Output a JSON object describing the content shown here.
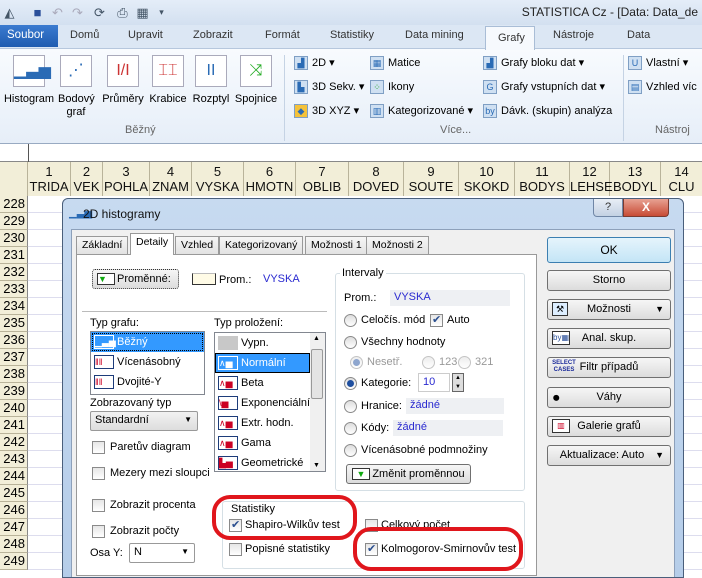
{
  "window": {
    "title": "STATISTICA Cz - [Data: Data_de"
  },
  "qat": {
    "icons": [
      "statistica-logo-icon",
      "save-icon",
      "undo-icon",
      "redo-icon",
      "refresh-icon",
      "print-icon",
      "customize-icon",
      "dropdown-icon"
    ]
  },
  "ribbon": {
    "file_tab": "Soubor",
    "tabs": [
      "Domů",
      "Upravit",
      "Zobrazit",
      "Formát",
      "Statistiky",
      "Data mining",
      "Grafy",
      "Nástroje",
      "Data"
    ],
    "active_tab": "Grafy",
    "groups": {
      "bezny": {
        "label": "Běžný",
        "buttons": [
          "Histogram",
          "Bodový graf",
          "Průměry",
          "Krabice",
          "Rozptyl",
          "Spojnice"
        ]
      },
      "vice": {
        "label": "Více...",
        "items": [
          "2D",
          "3D Sekv.",
          "3D XYZ",
          "Matice",
          "Ikony",
          "Kategorizované",
          "Grafy bloku dat",
          "Grafy vstupních dat",
          "Dávk. (skupin) analýza"
        ]
      },
      "nastroje": {
        "label": "Nástroj",
        "items": [
          "Vlastní",
          "Vzhled víc"
        ]
      }
    }
  },
  "grid": {
    "columns": [
      {
        "n": "1",
        "name": "TRIDA"
      },
      {
        "n": "2",
        "name": "VEK"
      },
      {
        "n": "3",
        "name": "POHLA"
      },
      {
        "n": "4",
        "name": "ZNAM"
      },
      {
        "n": "5",
        "name": "VYSKA"
      },
      {
        "n": "6",
        "name": "HMOTN"
      },
      {
        "n": "7",
        "name": "OBLIB"
      },
      {
        "n": "8",
        "name": "DOVED"
      },
      {
        "n": "9",
        "name": "SOUTE"
      },
      {
        "n": "10",
        "name": "SKOKD"
      },
      {
        "n": "11",
        "name": "BODYS"
      },
      {
        "n": "12",
        "name": "LEHSE"
      },
      {
        "n": "13",
        "name": "BODYL"
      },
      {
        "n": "14",
        "name": "CLU"
      }
    ],
    "rows": [
      "228",
      "229",
      "230",
      "231",
      "232",
      "233",
      "234",
      "235",
      "236",
      "237",
      "238",
      "239",
      "240",
      "241",
      "242",
      "243",
      "244",
      "245",
      "246",
      "247",
      "248",
      "249"
    ]
  },
  "dialog": {
    "title": "2D histogramy",
    "help": "?",
    "close": "X",
    "tabs": [
      "Základní",
      "Detaily",
      "Vzhled",
      "Kategorizovaný",
      "Možnosti 1",
      "Možnosti 2"
    ],
    "active_tab": "Detaily",
    "variables_button": "Proměnné:",
    "prom_label": "Prom.:",
    "prom_value": "VYSKA",
    "chart_type": {
      "label": "Typ grafu:",
      "items": [
        "Běžný",
        "Vícenásobný",
        "Dvojité-Y"
      ],
      "selected": "Běžný"
    },
    "display_type": {
      "label": "Zobrazovaný typ",
      "value": "Standardní"
    },
    "fit_type": {
      "label": "Typ proložení:",
      "items": [
        "Vypn.",
        "Normální",
        "Beta",
        "Exponenciální",
        "Extr. hodn.",
        "Gama",
        "Geometrické"
      ],
      "selected": "Normální"
    },
    "checks": {
      "pareto": {
        "label": "Paretův diagram",
        "checked": false
      },
      "gaps": {
        "label": "Mezery mezi sloupci",
        "checked": false
      },
      "percent": {
        "label": "Zobrazit procenta",
        "checked": false
      },
      "counts": {
        "label": "Zobrazit počty",
        "checked": false
      }
    },
    "y_axis": {
      "label": "Osa Y:",
      "value": "N"
    },
    "intervals": {
      "label": "Intervaly",
      "prom_label": "Prom.:",
      "prom_value": "VYSKA",
      "integer_mode": "Celočís. mód",
      "auto": "Auto",
      "auto_checked": true,
      "all_values": "Všechny hodnoty",
      "unsorted": "Nesetř.",
      "asc": "123",
      "desc": "321",
      "categories": "Kategorie:",
      "categories_value": "10",
      "bounds": "Hranice:",
      "bounds_value": "žádné",
      "codes": "Kódy:",
      "codes_value": "žádné",
      "multiple_subsets": "Vícenásobné podmnožiny",
      "selected": "Kategorie:",
      "change_variable": "Změnit proměnnou"
    },
    "statistics": {
      "label": "Statistiky",
      "shapiro": {
        "label": "Shapiro-Wilkův test",
        "checked": true
      },
      "descriptive": {
        "label": "Popisné statistiky",
        "checked": false
      },
      "total": {
        "label": "Celkový počet",
        "checked": false
      },
      "ks": {
        "label": "Kolmogorov-Smirnovův test",
        "checked": true
      }
    },
    "buttons": {
      "ok": "OK",
      "cancel": "Storno",
      "options": "Možnosti",
      "by_group": "Anal. skup.",
      "select_cases": "Filtr případů",
      "select_cases_icon": "SELECT CASES",
      "weights": "Váhy",
      "gallery": "Galerie grafů",
      "update": "Aktualizace: Auto"
    },
    "highlight_color": "#e0161c"
  }
}
